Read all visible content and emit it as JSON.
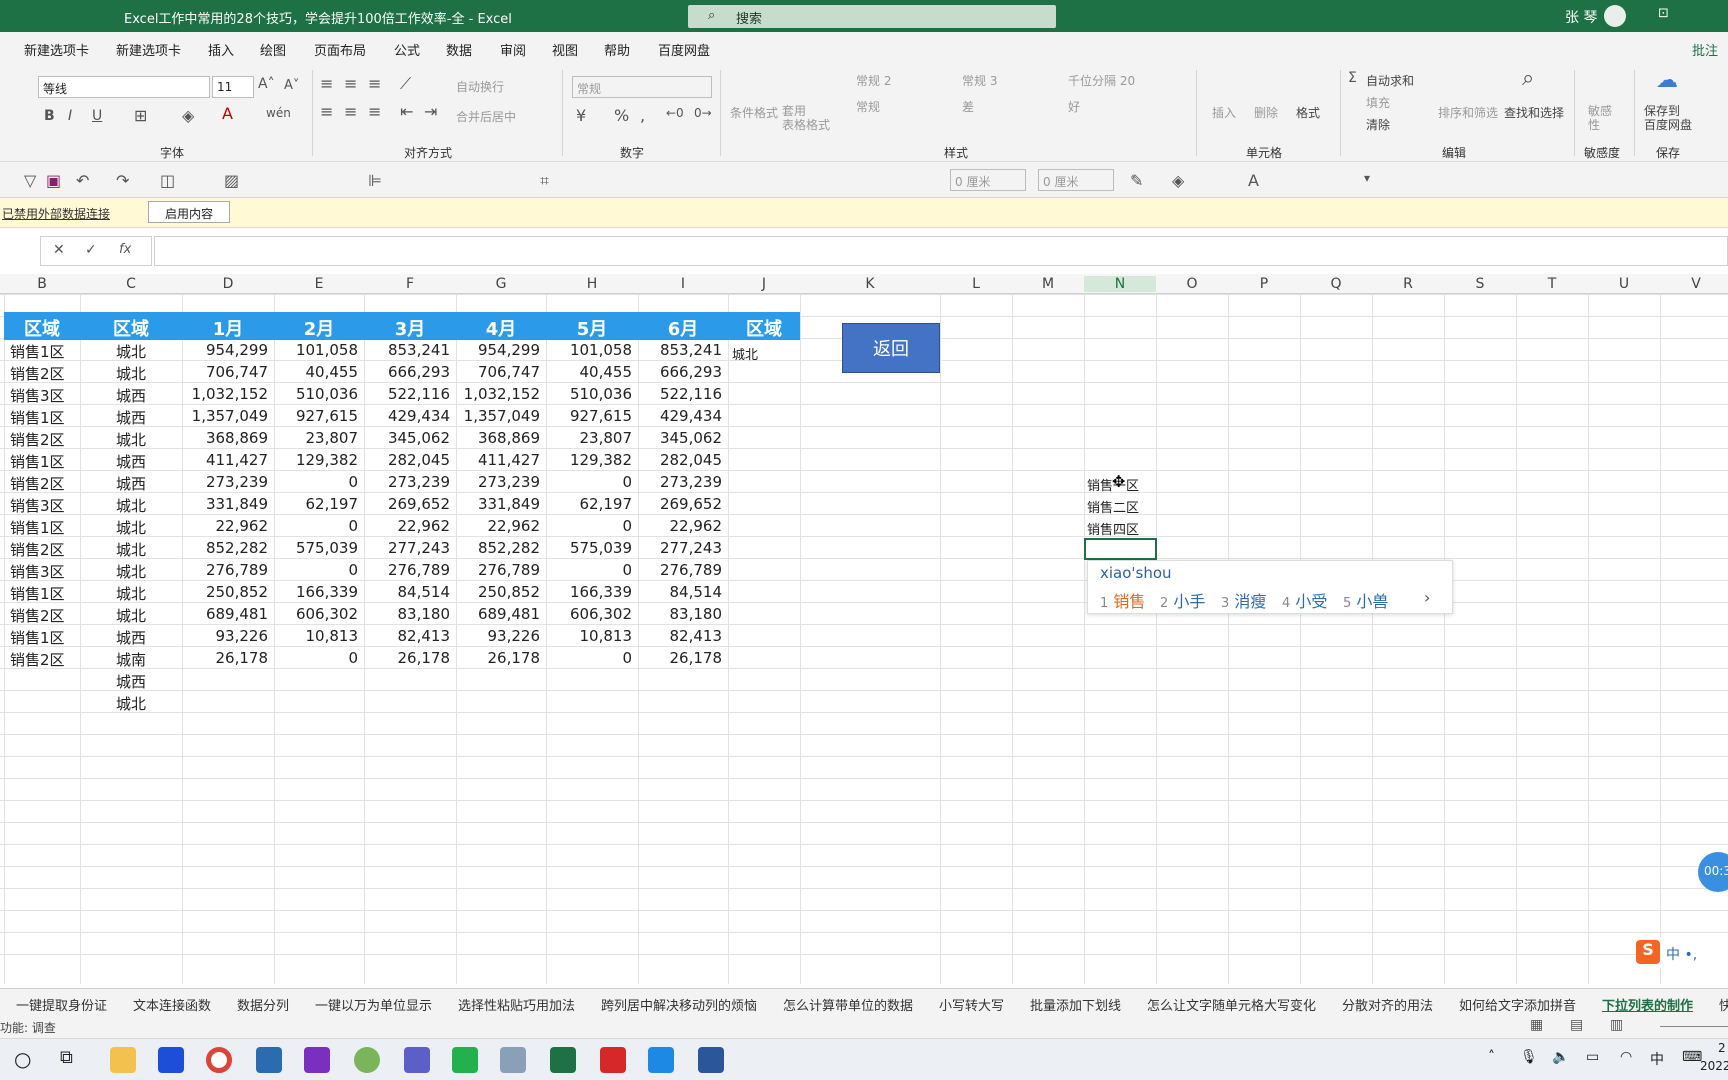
{
  "window": {
    "title": "Excel工作中常用的28个技巧，学会提升100倍工作效率-全  -  Excel",
    "search": "搜索",
    "user": "张 琴"
  },
  "menu": [
    "新建选项卡",
    "新建选项卡",
    "插入",
    "绘图",
    "页面布局",
    "公式",
    "数据",
    "审阅",
    "视图",
    "帮助",
    "百度网盘"
  ],
  "menu_right": "批注",
  "ribbon": {
    "font_name": "等线",
    "font_size": "11",
    "number_format": "常规",
    "wrap_text": "自动换行",
    "merge_center": "合并后居中",
    "cond_format": "条件格式",
    "table_format": "套用\n表格格式",
    "styles": [
      "常规 2",
      "常规 3",
      "千位分隔 20",
      "常规",
      "差",
      "好"
    ],
    "insert": "插入",
    "delete": "删除",
    "format": "格式",
    "autosum": "自动求和",
    "fill": "填充",
    "clear": "清除",
    "sort_filter": "排序和筛选",
    "find_select": "查找和选择",
    "sensitivity": "敏感\n性",
    "save_baidu": "保存到\n百度网盘",
    "groups": {
      "font": "字体",
      "align": "对齐方式",
      "number": "数字",
      "styles": "样式",
      "cells": "单元格",
      "edit": "编辑",
      "sensitivity": "敏感度",
      "save": "保存"
    }
  },
  "qat": {
    "width1": "0 厘米",
    "width2": "0 厘米"
  },
  "message_bar": {
    "text": "已禁用外部数据连接",
    "button": "启用内容"
  },
  "formula_bar": {
    "fx": "fx",
    "value": ""
  },
  "columns": [
    "B",
    "C",
    "D",
    "E",
    "F",
    "G",
    "H",
    "I",
    "J",
    "K",
    "L",
    "M",
    "N",
    "O",
    "P",
    "Q",
    "R",
    "S",
    "T",
    "U",
    "V"
  ],
  "table": {
    "headers": [
      "区域",
      "区域",
      "1月",
      "2月",
      "3月",
      "4月",
      "5月",
      "6月",
      "区域"
    ],
    "rows": [
      [
        "销售1区",
        "城北",
        "954,299",
        "101,058",
        "853,241",
        "954,299",
        "101,058",
        "853,241"
      ],
      [
        "销售2区",
        "城北",
        "706,747",
        "40,455",
        "666,293",
        "706,747",
        "40,455",
        "666,293"
      ],
      [
        "销售3区",
        "城西",
        "1,032,152",
        "510,036",
        "522,116",
        "1,032,152",
        "510,036",
        "522,116"
      ],
      [
        "销售1区",
        "城西",
        "1,357,049",
        "927,615",
        "429,434",
        "1,357,049",
        "927,615",
        "429,434"
      ],
      [
        "销售2区",
        "城北",
        "368,869",
        "23,807",
        "345,062",
        "368,869",
        "23,807",
        "345,062"
      ],
      [
        "销售1区",
        "城西",
        "411,427",
        "129,382",
        "282,045",
        "411,427",
        "129,382",
        "282,045"
      ],
      [
        "销售2区",
        "城西",
        "273,239",
        "0",
        "273,239",
        "273,239",
        "0",
        "273,239"
      ],
      [
        "销售3区",
        "城北",
        "331,849",
        "62,197",
        "269,652",
        "331,849",
        "62,197",
        "269,652"
      ],
      [
        "销售1区",
        "城北",
        "22,962",
        "0",
        "22,962",
        "22,962",
        "0",
        "22,962"
      ],
      [
        "销售2区",
        "城北",
        "852,282",
        "575,039",
        "277,243",
        "852,282",
        "575,039",
        "277,243"
      ],
      [
        "销售3区",
        "城北",
        "276,789",
        "0",
        "276,789",
        "276,789",
        "0",
        "276,789"
      ],
      [
        "销售1区",
        "城北",
        "250,852",
        "166,339",
        "84,514",
        "250,852",
        "166,339",
        "84,514"
      ],
      [
        "销售2区",
        "城北",
        "689,481",
        "606,302",
        "83,180",
        "689,481",
        "606,302",
        "83,180"
      ],
      [
        "销售1区",
        "城西",
        "93,226",
        "10,813",
        "82,413",
        "93,226",
        "10,813",
        "82,413"
      ],
      [
        "销售2区",
        "城南",
        "26,178",
        "0",
        "26,178",
        "26,178",
        "0",
        "26,178"
      ]
    ],
    "extra_c": [
      "城西",
      "城北"
    ],
    "j_value": "城北"
  },
  "back_button": "返回",
  "n_column": [
    "销售一区",
    "销售二区",
    "销售四区"
  ],
  "ime": {
    "input": "xiao'shou",
    "candidates": [
      {
        "n": "1",
        "text": "销售"
      },
      {
        "n": "2",
        "text": "小手"
      },
      {
        "n": "3",
        "text": "消瘦"
      },
      {
        "n": "4",
        "text": "小受"
      },
      {
        "n": "5",
        "text": "小兽"
      }
    ],
    "next": "›"
  },
  "sheet_tabs": [
    "一键提取身份证",
    "文本连接函数",
    "数据分列",
    "一键以万为单位显示",
    "选择性粘贴巧用加法",
    "跨列居中解决移动列的烦恼",
    "怎么计算带单位的数据",
    "小写转大写",
    "批量添加下划线",
    "怎么让文字随单元格大写变化",
    "分散对齐的用法",
    "如何给文字添加拼音",
    "下拉列表的制作",
    "快速"
  ],
  "active_tab": "下拉列表的制作",
  "status": {
    "left": "功能: 调查"
  },
  "timer": "00:3",
  "sogou": "中 •,",
  "clock": {
    "time": "2",
    "date": "2022"
  },
  "colors": {
    "excel_green": "#1e7145",
    "header_blue": "#2b9ae8",
    "button_blue": "#4472c4"
  }
}
